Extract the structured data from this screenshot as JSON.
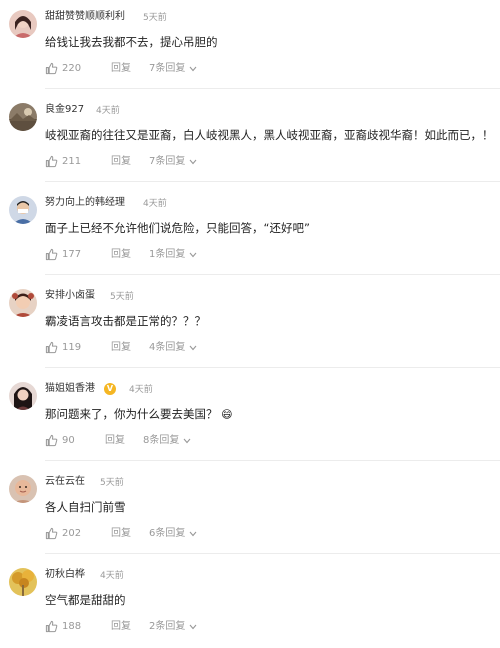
{
  "comments": [
    {
      "username": "甜甜赞赞顺顺利利",
      "time": "5天前",
      "content": "给钱让我去我都不去，提心吊胆的",
      "likes": "220",
      "reply_label": "回复",
      "reply_count": "7条回复",
      "avatar_icon": "avatar-woman-icon",
      "avatar_color": "#c96b6b"
    },
    {
      "username": "良金927",
      "time": "4天前",
      "content": "岐视亚裔的往往又是亚裔，白人岐视黑人，黑人岐视亚裔，亚裔歧视华裔！如此而已，！",
      "likes": "211",
      "reply_label": "回复",
      "reply_count": "7条回复",
      "avatar_icon": "avatar-landscape-icon",
      "avatar_color": "#7a6a58"
    },
    {
      "username": "努力向上的韩经理",
      "time": "4天前",
      "content": "面子上已经不允许他们说危险，只能回答，“还好吧”",
      "likes": "177",
      "reply_label": "回复",
      "reply_count": "1条回复",
      "avatar_icon": "avatar-man-icon",
      "avatar_color": "#4a6fa5"
    },
    {
      "username": "安排小卤蛋",
      "time": "5天前",
      "content": "霸凌语言攻击都是正常的？？？",
      "likes": "119",
      "reply_label": "回复",
      "reply_count": "4条回复",
      "avatar_icon": "avatar-child-icon",
      "avatar_color": "#b04a3a"
    },
    {
      "username": "猫姐姐香港",
      "time": "4天前",
      "content": "那问题来了，你为什么要去美国？",
      "emoji": "😄",
      "likes": "90",
      "reply_label": "回复",
      "reply_count": "8条回复",
      "verified": "V",
      "avatar_icon": "avatar-woman-dark-hair-icon",
      "avatar_color": "#6b3a3a"
    },
    {
      "username": "云在云在",
      "time": "5天前",
      "content": "各人自扫门前雪",
      "likes": "202",
      "reply_label": "回复",
      "reply_count": "6条回复",
      "avatar_icon": "avatar-baby-icon",
      "avatar_color": "#c4957a"
    },
    {
      "username": "初秋白桦",
      "time": "4天前",
      "content": "空气都是甜甜的",
      "likes": "188",
      "reply_label": "回复",
      "reply_count": "2条回复",
      "avatar_icon": "avatar-autumn-tree-icon",
      "avatar_color": "#c9a23a"
    }
  ]
}
